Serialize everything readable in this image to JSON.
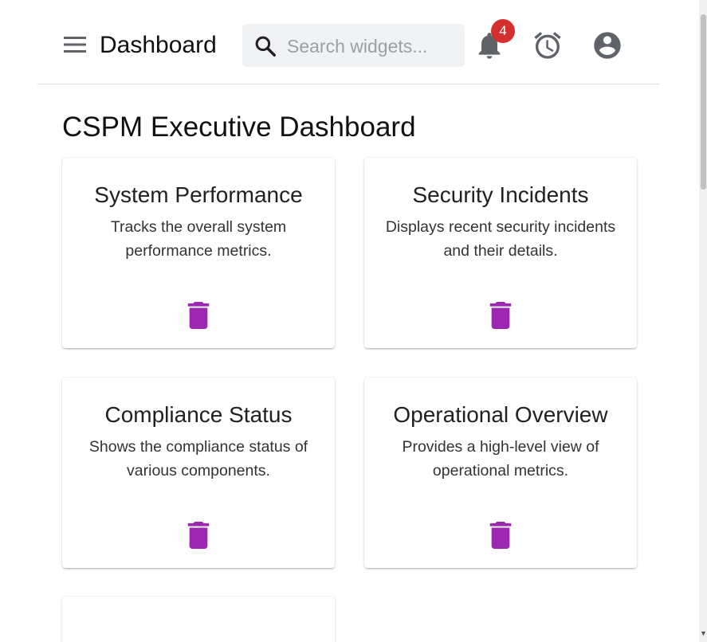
{
  "header": {
    "title": "Dashboard",
    "search": {
      "placeholder": "Search widgets...",
      "value": ""
    },
    "notifications": {
      "count": "4"
    }
  },
  "main": {
    "title": "CSPM Executive Dashboard",
    "widgets": [
      {
        "title": "System Performance",
        "description": "Tracks the overall system performance metrics."
      },
      {
        "title": "Security Incidents",
        "description": "Displays recent security incidents and their details."
      },
      {
        "title": "Compliance Status",
        "description": "Shows the compliance status of various components."
      },
      {
        "title": "Operational Overview",
        "description": "Provides a high-level view of operational metrics."
      }
    ]
  },
  "colors": {
    "accent": "#9c27b0",
    "badge": "#d32f2f",
    "icon": "#5f6368"
  },
  "icons": {
    "menu": "menu-icon",
    "search": "search-icon",
    "notifications": "bell-icon",
    "alarm": "alarm-icon",
    "account": "account-circle-icon",
    "delete": "trash-icon"
  }
}
